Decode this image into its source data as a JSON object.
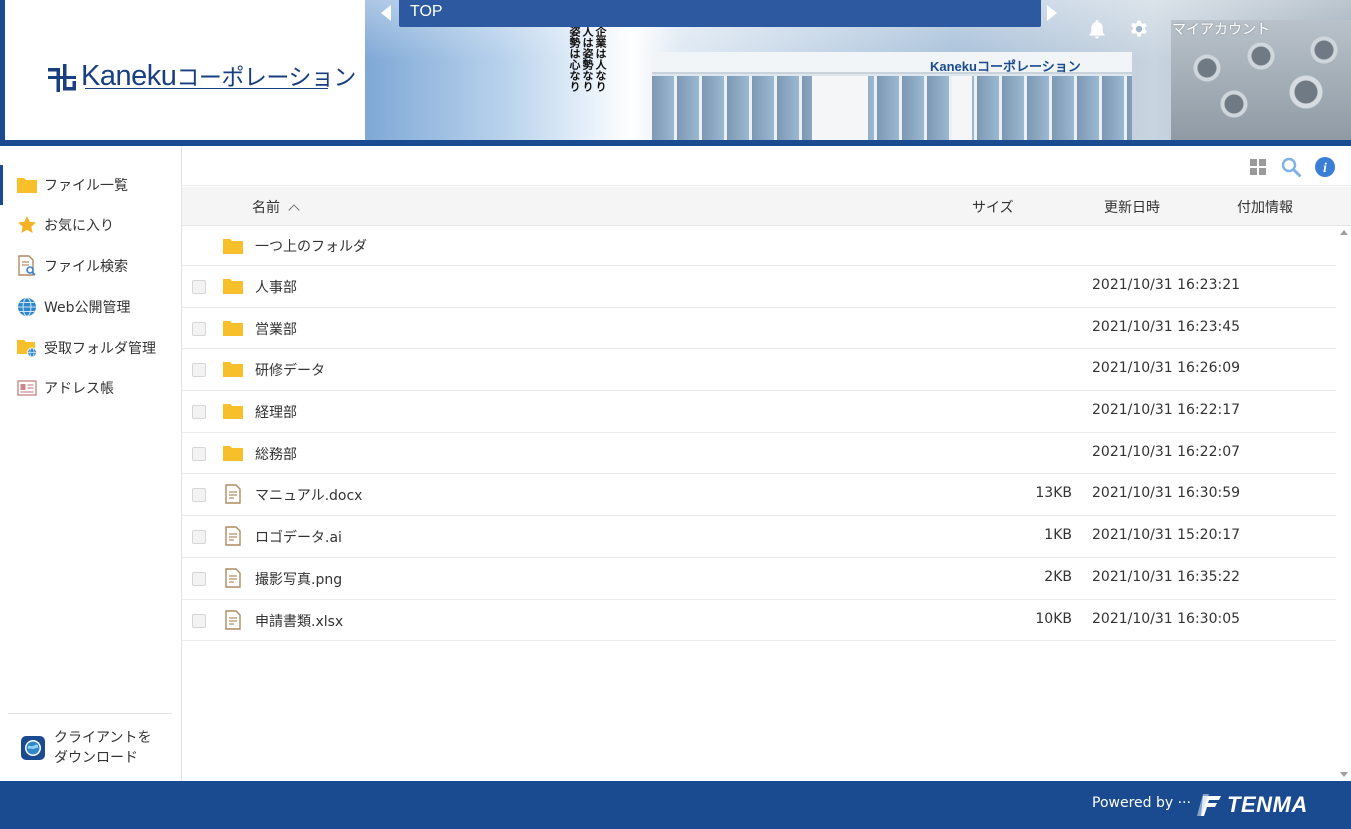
{
  "header": {
    "logo_latin": "Kaneku",
    "logo_kana": "コーポレーション",
    "nav_title": "TOP",
    "motto_lines": [
      "企業は人なり",
      "人は姿勢なり",
      "姿勢は心なり"
    ],
    "building_sign": "Kanekuコーポレーション",
    "account_label": "マイアカウント"
  },
  "sidebar": {
    "items": [
      {
        "label": "ファイル一覧",
        "icon": "folder-icon",
        "active": true
      },
      {
        "label": "お気に入り",
        "icon": "star-icon"
      },
      {
        "label": "ファイル検索",
        "icon": "file-search-icon"
      },
      {
        "label": "Web公開管理",
        "icon": "globe-icon"
      },
      {
        "label": "受取フォルダ管理",
        "icon": "folder-globe-icon"
      },
      {
        "label": "アドレス帳",
        "icon": "address-card-icon"
      }
    ],
    "client_download": {
      "line1": "クライアントを",
      "line2": "ダウンロード"
    }
  },
  "table": {
    "columns": {
      "name": "名前",
      "size": "サイズ",
      "updated": "更新日時",
      "extra": "付加情報"
    },
    "parent_folder": "一つ上のフォルダ",
    "rows": [
      {
        "type": "folder",
        "name": "人事部",
        "size": "",
        "updated": "2021/10/31 16:23:21"
      },
      {
        "type": "folder",
        "name": "営業部",
        "size": "",
        "updated": "2021/10/31 16:23:45"
      },
      {
        "type": "folder",
        "name": "研修データ",
        "size": "",
        "updated": "2021/10/31 16:26:09"
      },
      {
        "type": "folder",
        "name": "経理部",
        "size": "",
        "updated": "2021/10/31 16:22:17"
      },
      {
        "type": "folder",
        "name": "総務部",
        "size": "",
        "updated": "2021/10/31 16:22:07"
      },
      {
        "type": "file",
        "name": "マニュアル.docx",
        "size": "13KB",
        "updated": "2021/10/31 16:30:59"
      },
      {
        "type": "file",
        "name": "ロゴデータ.ai",
        "size": "1KB",
        "updated": "2021/10/31 15:20:17"
      },
      {
        "type": "file",
        "name": "撮影写真.png",
        "size": "2KB",
        "updated": "2021/10/31 16:35:22"
      },
      {
        "type": "file",
        "name": "申請書類.xlsx",
        "size": "10KB",
        "updated": "2021/10/31 16:30:05"
      }
    ]
  },
  "footer": {
    "powered_by": "Powered by ···",
    "brand": "TENMA"
  },
  "colors": {
    "brand_blue": "#1a4a8f",
    "nav_blue": "#2c59a0",
    "folder_yellow": "#f7bf2a",
    "info_blue": "#3a7fd5"
  }
}
